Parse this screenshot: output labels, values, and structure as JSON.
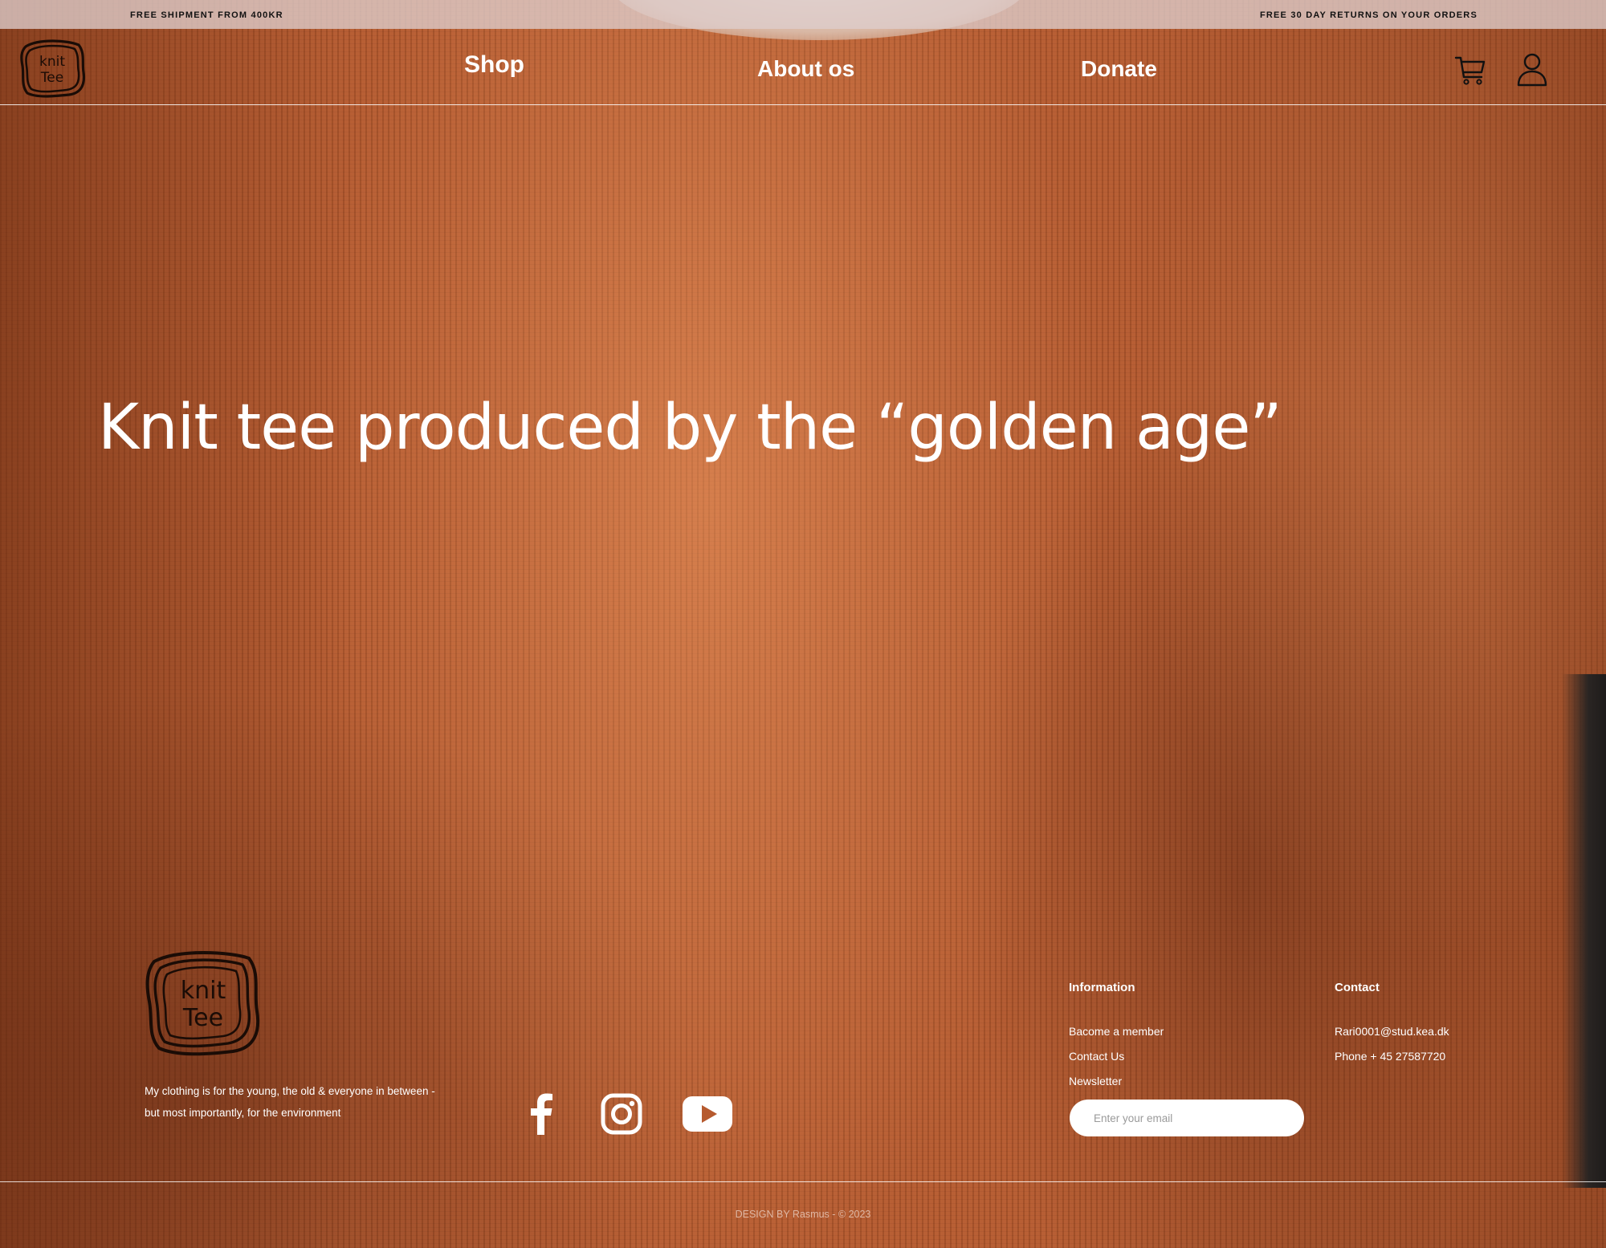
{
  "announcement": {
    "left": "FREE SHIPMENT FROM 400KR",
    "right": "FREE 30 DAY RETURNS ON YOUR ORDERS"
  },
  "brand": {
    "logo_line1": "knit",
    "logo_line2": "Tee"
  },
  "nav": {
    "items": [
      {
        "label": "Shop"
      },
      {
        "label": "About os"
      },
      {
        "label": "Donate"
      }
    ],
    "icons": [
      "cart-icon",
      "user-icon"
    ]
  },
  "hero": {
    "title": "Knit tee produced by the “golden age”"
  },
  "footer": {
    "tagline": "My clothing is for the young, the old & everyone in between - but most importantly, for the environment",
    "social_icons": [
      "facebook-icon",
      "instagram-icon",
      "youtube-icon"
    ],
    "information": {
      "heading": "Information",
      "items": [
        "Bacome a member",
        "Contact Us",
        "Newsletter"
      ],
      "email_placeholder": "Enter your email"
    },
    "contact": {
      "heading": "Contact",
      "items": [
        "Rari0001@stud.kea.dk",
        "Phone + 45 27587720"
      ]
    },
    "copyright": "DESIGN BY Rasmus - © 2023"
  },
  "colors": {
    "background": "#b65a2e",
    "announcement_bar": "#decdcc",
    "text": "#ffffff"
  }
}
